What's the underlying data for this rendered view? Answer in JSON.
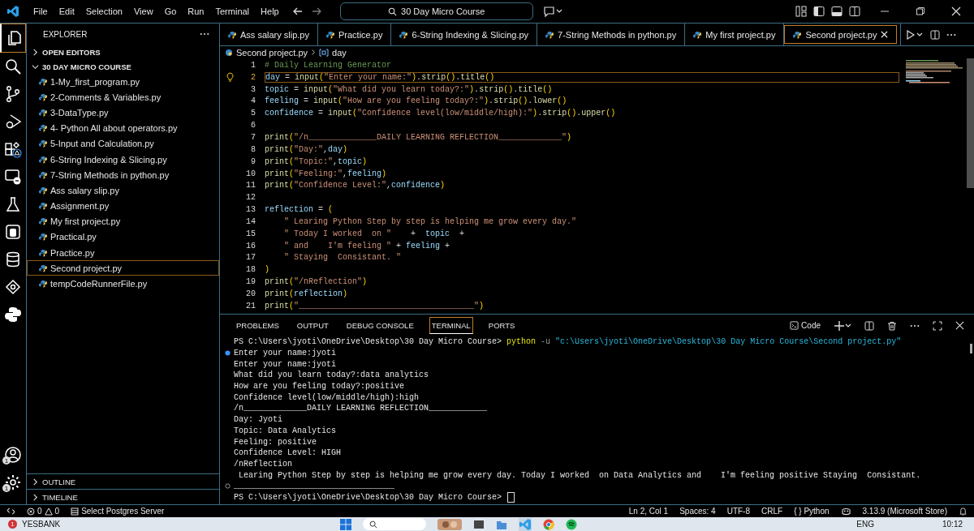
{
  "title_bar": {
    "menu": [
      "File",
      "Edit",
      "Selection",
      "View",
      "Go",
      "Run",
      "Terminal",
      "Help"
    ],
    "search": "30 Day Micro Course"
  },
  "activity_bar": {
    "items": [
      {
        "kind": "explorer",
        "selected": true
      },
      {
        "kind": "search",
        "selected": false
      },
      {
        "kind": "source-control",
        "selected": false
      },
      {
        "kind": "run-debug",
        "selected": false
      },
      {
        "kind": "extensions",
        "selected": false
      },
      {
        "kind": "remote",
        "selected": false
      },
      {
        "kind": "testing",
        "selected": false
      },
      {
        "kind": "container",
        "selected": false
      },
      {
        "kind": "database",
        "selected": false
      },
      {
        "kind": "cloud",
        "selected": false
      },
      {
        "kind": "python",
        "selected": false
      }
    ],
    "bottom": [
      {
        "kind": "account",
        "badge": "1"
      },
      {
        "kind": "settings",
        "badge": "1"
      }
    ]
  },
  "sidebar": {
    "title": "EXPLORER",
    "sections": [
      {
        "label": "OPEN EDITORS",
        "expanded": false
      },
      {
        "label": "30 DAY MICRO COURSE",
        "expanded": true
      }
    ],
    "files": [
      {
        "name": "1-My_first_program.py",
        "selected": false
      },
      {
        "name": "2-Comments & Variables.py",
        "selected": false
      },
      {
        "name": "3-DataType.py",
        "selected": false
      },
      {
        "name": "4- Python All about operators.py",
        "selected": false
      },
      {
        "name": "5-Input and Calculation.py",
        "selected": false
      },
      {
        "name": "6-String Indexing & Slicing.py",
        "selected": false
      },
      {
        "name": "7-String Methods in python.py",
        "selected": false
      },
      {
        "name": "Ass salary slip.py",
        "selected": false
      },
      {
        "name": "Assignment.py",
        "selected": false
      },
      {
        "name": "My first project.py",
        "selected": false
      },
      {
        "name": "Practical.py",
        "selected": false
      },
      {
        "name": "Practice.py",
        "selected": false
      },
      {
        "name": "Second project.py",
        "selected": true
      },
      {
        "name": "tempCodeRunnerFile.py",
        "selected": false
      }
    ],
    "bottom_sections": [
      {
        "label": "OUTLINE",
        "expanded": false
      },
      {
        "label": "TIMELINE",
        "expanded": false
      }
    ]
  },
  "tabs": [
    {
      "label": "Ass salary slip.py",
      "selected": false
    },
    {
      "label": "Practice.py",
      "selected": false
    },
    {
      "label": "6-String Indexing & Slicing.py",
      "selected": false
    },
    {
      "label": "7-String Methods in python.py",
      "selected": false
    },
    {
      "label": "My first project.py",
      "selected": false
    },
    {
      "label": "Second project.py",
      "selected": true
    }
  ],
  "breadcrumb": [
    "Second project.py",
    "day"
  ],
  "editor": {
    "lines": [
      {
        "number": "1",
        "current": false,
        "tokens": [
          {
            "kind": "comment",
            "text": "# Daily Learning Generator"
          }
        ]
      },
      {
        "number": "2",
        "current": true,
        "tokens": [
          {
            "kind": "variable",
            "text": "day"
          },
          {
            "kind": "operator",
            "text": " = "
          },
          {
            "kind": "function",
            "text": "input"
          },
          {
            "kind": "bracket",
            "text": "("
          },
          {
            "kind": "string",
            "text": "\"Enter your name:\""
          },
          {
            "kind": "bracket",
            "text": ")"
          },
          {
            "kind": "operator",
            "text": "."
          },
          {
            "kind": "function",
            "text": "strip"
          },
          {
            "kind": "bracket",
            "text": "()"
          },
          {
            "kind": "operator",
            "text": "."
          },
          {
            "kind": "function",
            "text": "title"
          },
          {
            "kind": "bracket",
            "text": "()"
          }
        ]
      },
      {
        "number": "3",
        "current": false,
        "tokens": [
          {
            "kind": "variable",
            "text": "topic"
          },
          {
            "kind": "operator",
            "text": " = "
          },
          {
            "kind": "function",
            "text": "input"
          },
          {
            "kind": "bracket",
            "text": "("
          },
          {
            "kind": "string",
            "text": "\"What did you learn today?:\""
          },
          {
            "kind": "bracket",
            "text": ")"
          },
          {
            "kind": "operator",
            "text": "."
          },
          {
            "kind": "function",
            "text": "strip"
          },
          {
            "kind": "bracket",
            "text": "()"
          },
          {
            "kind": "operator",
            "text": "."
          },
          {
            "kind": "function",
            "text": "title"
          },
          {
            "kind": "bracket",
            "text": "()"
          }
        ]
      },
      {
        "number": "4",
        "current": false,
        "tokens": [
          {
            "kind": "variable",
            "text": "feeling"
          },
          {
            "kind": "operator",
            "text": " = "
          },
          {
            "kind": "function",
            "text": "input"
          },
          {
            "kind": "bracket",
            "text": "("
          },
          {
            "kind": "string",
            "text": "\"How are you feeling today?:\""
          },
          {
            "kind": "bracket",
            "text": ")"
          },
          {
            "kind": "operator",
            "text": "."
          },
          {
            "kind": "function",
            "text": "strip"
          },
          {
            "kind": "bracket",
            "text": "()"
          },
          {
            "kind": "operator",
            "text": "."
          },
          {
            "kind": "function",
            "text": "lower"
          },
          {
            "kind": "bracket",
            "text": "()"
          }
        ]
      },
      {
        "number": "5",
        "current": false,
        "tokens": [
          {
            "kind": "variable",
            "text": "confidence"
          },
          {
            "kind": "operator",
            "text": " = "
          },
          {
            "kind": "function",
            "text": "input"
          },
          {
            "kind": "bracket",
            "text": "("
          },
          {
            "kind": "string",
            "text": "\"Confidence level(low/middle/high):\""
          },
          {
            "kind": "bracket",
            "text": ")"
          },
          {
            "kind": "operator",
            "text": "."
          },
          {
            "kind": "function",
            "text": "strip"
          },
          {
            "kind": "bracket",
            "text": "()"
          },
          {
            "kind": "operator",
            "text": "."
          },
          {
            "kind": "function",
            "text": "upper"
          },
          {
            "kind": "bracket",
            "text": "()"
          }
        ]
      },
      {
        "number": "6",
        "current": false
      },
      {
        "number": "7",
        "current": false,
        "tokens": [
          {
            "kind": "function",
            "text": "print"
          },
          {
            "kind": "bracket",
            "text": "("
          },
          {
            "kind": "string",
            "text": "\"/n______________DAILY LEARNING REFLECTION_____________\""
          },
          {
            "kind": "bracket",
            "text": ")"
          }
        ]
      },
      {
        "number": "8",
        "current": false,
        "tokens": [
          {
            "kind": "function",
            "text": "print"
          },
          {
            "kind": "bracket",
            "text": "("
          },
          {
            "kind": "string",
            "text": "\"Day:\""
          },
          {
            "kind": "operator",
            "text": ","
          },
          {
            "kind": "variable",
            "text": "day"
          },
          {
            "kind": "bracket",
            "text": ")"
          }
        ]
      },
      {
        "number": "9",
        "current": false,
        "tokens": [
          {
            "kind": "function",
            "text": "print"
          },
          {
            "kind": "bracket",
            "text": "("
          },
          {
            "kind": "string",
            "text": "\"Topic:\""
          },
          {
            "kind": "operator",
            "text": ","
          },
          {
            "kind": "variable",
            "text": "topic"
          },
          {
            "kind": "bracket",
            "text": ")"
          }
        ]
      },
      {
        "number": "10",
        "current": false,
        "tokens": [
          {
            "kind": "function",
            "text": "print"
          },
          {
            "kind": "bracket",
            "text": "("
          },
          {
            "kind": "string",
            "text": "\"Feeling:\""
          },
          {
            "kind": "operator",
            "text": ","
          },
          {
            "kind": "variable",
            "text": "feeling"
          },
          {
            "kind": "bracket",
            "text": ")"
          }
        ]
      },
      {
        "number": "11",
        "current": false,
        "tokens": [
          {
            "kind": "function",
            "text": "print"
          },
          {
            "kind": "bracket",
            "text": "("
          },
          {
            "kind": "string",
            "text": "\"Confidence Level:\""
          },
          {
            "kind": "operator",
            "text": ","
          },
          {
            "kind": "variable",
            "text": "confidence"
          },
          {
            "kind": "bracket",
            "text": ")"
          }
        ]
      },
      {
        "number": "12",
        "current": false
      },
      {
        "number": "13",
        "current": false,
        "tokens": [
          {
            "kind": "variable",
            "text": "reflection"
          },
          {
            "kind": "operator",
            "text": " = "
          },
          {
            "kind": "bracket",
            "text": "("
          }
        ]
      },
      {
        "number": "14",
        "current": false,
        "tokens": [
          {
            "kind": "string",
            "text": "    \" Learing Python Step by step is helping me grow every day.\""
          }
        ]
      },
      {
        "number": "15",
        "current": false,
        "tokens": [
          {
            "kind": "string",
            "text": "    \" Today I worked  on \""
          },
          {
            "kind": "operator",
            "text": "    +  "
          },
          {
            "kind": "variable",
            "text": "topic"
          },
          {
            "kind": "operator",
            "text": "  +"
          }
        ]
      },
      {
        "number": "16",
        "current": false,
        "tokens": [
          {
            "kind": "string",
            "text": "    \" and    I'm feeling \""
          },
          {
            "kind": "operator",
            "text": " + "
          },
          {
            "kind": "variable",
            "text": "feeling"
          },
          {
            "kind": "operator",
            "text": " +"
          }
        ]
      },
      {
        "number": "17",
        "current": false,
        "tokens": [
          {
            "kind": "string",
            "text": "    \" Staying  Consistant. \""
          }
        ]
      },
      {
        "number": "18",
        "current": false,
        "tokens": [
          {
            "kind": "bracket",
            "text": ")"
          }
        ]
      },
      {
        "number": "19",
        "current": false,
        "tokens": [
          {
            "kind": "function",
            "text": "print"
          },
          {
            "kind": "bracket",
            "text": "("
          },
          {
            "kind": "string",
            "text": "\"/nReflection\""
          },
          {
            "kind": "bracket",
            "text": ")"
          }
        ]
      },
      {
        "number": "20",
        "current": false,
        "tokens": [
          {
            "kind": "function",
            "text": "print"
          },
          {
            "kind": "bracket",
            "text": "("
          },
          {
            "kind": "variable",
            "text": "reflection"
          },
          {
            "kind": "bracket",
            "text": ")"
          }
        ]
      },
      {
        "number": "21",
        "current": false,
        "tokens": [
          {
            "kind": "function",
            "text": "print"
          },
          {
            "kind": "bracket",
            "text": "("
          },
          {
            "kind": "string",
            "text": "\"____________________________________\""
          },
          {
            "kind": "bracket",
            "text": ")"
          }
        ]
      }
    ]
  },
  "panel": {
    "tabs": [
      {
        "label": "PROBLEMS",
        "selected": false
      },
      {
        "label": "OUTPUT",
        "selected": false
      },
      {
        "label": "DEBUG CONSOLE",
        "selected": false
      },
      {
        "label": "TERMINAL",
        "selected": true
      },
      {
        "label": "PORTS",
        "selected": false
      }
    ],
    "terminal_name": "Code",
    "lines": [
      {
        "kind": "command",
        "tokens": [
          {
            "kind": "plain",
            "text": "PS C:\\Users\\jyoti\\OneDrive\\Desktop\\30 Day Micro Course> "
          },
          {
            "kind": "command",
            "text": "python"
          },
          {
            "kind": "flag",
            "text": " -u "
          },
          {
            "kind": "string",
            "text": "\"c:\\Users\\jyoti\\OneDrive\\Desktop\\30 Day Micro Course\\Second project.py\""
          }
        ]
      },
      {
        "kind": "output-first",
        "tokens": [
          {
            "kind": "plain",
            "text": "Enter your name:jyoti"
          }
        ]
      },
      {
        "kind": "output",
        "tokens": [
          {
            "kind": "plain",
            "text": "Enter your name:jyoti"
          }
        ]
      },
      {
        "kind": "output",
        "tokens": [
          {
            "kind": "plain",
            "text": "What did you learn today?:data analytics"
          }
        ]
      },
      {
        "kind": "output",
        "tokens": [
          {
            "kind": "plain",
            "text": "How are you feeling today?:positive"
          }
        ]
      },
      {
        "kind": "output",
        "tokens": [
          {
            "kind": "plain",
            "text": "Confidence level(low/middle/high):high"
          }
        ]
      },
      {
        "kind": "output",
        "tokens": [
          {
            "kind": "plain",
            "text": "/n_____________DAILY LEARNING REFLECTION____________"
          }
        ]
      },
      {
        "kind": "output",
        "tokens": [
          {
            "kind": "plain",
            "text": "Day: Jyoti"
          }
        ]
      },
      {
        "kind": "output",
        "tokens": [
          {
            "kind": "plain",
            "text": "Topic: Data Analytics"
          }
        ]
      },
      {
        "kind": "output",
        "tokens": [
          {
            "kind": "plain",
            "text": "Feeling: positive"
          }
        ]
      },
      {
        "kind": "output",
        "tokens": [
          {
            "kind": "plain",
            "text": "Confidence Level: HIGH"
          }
        ]
      },
      {
        "kind": "output",
        "tokens": [
          {
            "kind": "plain",
            "text": "/nReflection"
          }
        ]
      },
      {
        "kind": "output",
        "tokens": [
          {
            "kind": "plain",
            "text": " Learing Python Step by step is helping me grow every day. Today I worked  on Data Analytics and    I'm feeling positive Staying  Consistant."
          }
        ]
      },
      {
        "kind": "output-last",
        "tokens": [
          {
            "kind": "plain",
            "text": "_________________________________"
          }
        ]
      },
      {
        "kind": "prompt",
        "tokens": [
          {
            "kind": "plain",
            "text": "PS C:\\Users\\jyoti\\OneDrive\\Desktop\\30 Day Micro Course> "
          }
        ]
      }
    ]
  },
  "status_bar": {
    "errors": "0",
    "warnings": "0",
    "postgres": "Select Postgres Server",
    "position": "Ln 2, Col 1",
    "spaces": "Spaces: 4",
    "encoding": "UTF-8",
    "eol": "CRLF",
    "language_brace": "{ }",
    "language": "Python",
    "interpreter": "3.13.9 (Microsoft Store)"
  },
  "taskbar": {
    "notification_badge": "1",
    "stock": "YESBANK",
    "language": "ENG",
    "time": "10:12"
  }
}
